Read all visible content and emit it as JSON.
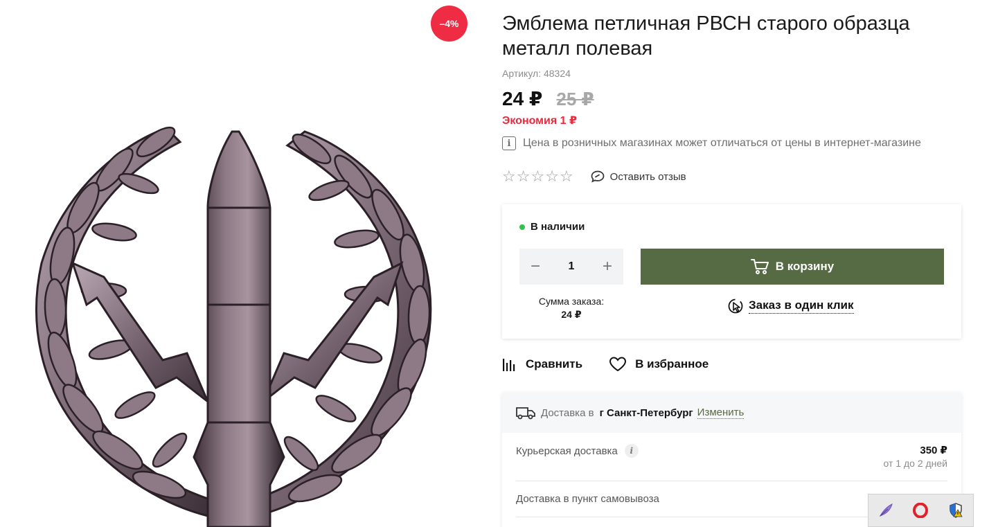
{
  "product": {
    "discount_badge": "–4%",
    "title": "Эмблема петличная РВСН старого образца металл полевая",
    "sku": "Артикул: 48324",
    "price": "24 ₽",
    "old_price": "25 ₽",
    "economy": "Экономия 1 ₽",
    "price_notice": "Цена в розничных магазинах может отличаться от цены в интернет-магазине",
    "rating": 0,
    "rating_max": 5,
    "review_link": "Оставить отзыв"
  },
  "buybox": {
    "stock": "В наличии",
    "quantity": "1",
    "minus": "−",
    "plus": "+",
    "cart_button": "В корзину",
    "sum_label": "Сумма заказа:",
    "sum_value": "24 ₽",
    "one_click": "Заказ в один клик"
  },
  "actions": {
    "compare": "Сравнить",
    "favorite": "В избранное"
  },
  "delivery": {
    "label": "Доставка в",
    "city": "г Санкт-Петербург",
    "change": "Изменить",
    "rows": [
      {
        "name": "Курьерская доставка",
        "price": "350 ₽",
        "term": "от 1 до 2 дней"
      },
      {
        "name": "Доставка в пункт самовывоза"
      }
    ]
  },
  "colors": {
    "accent_green": "#566b44",
    "sale_red": "#ee2d44",
    "economy_red": "#e8293e",
    "in_stock_green": "#2fc34b"
  },
  "icons": {
    "product_image": "rvsn-emblem-image",
    "tray": [
      "feather-icon",
      "opera-icon",
      "shield-icon"
    ]
  }
}
